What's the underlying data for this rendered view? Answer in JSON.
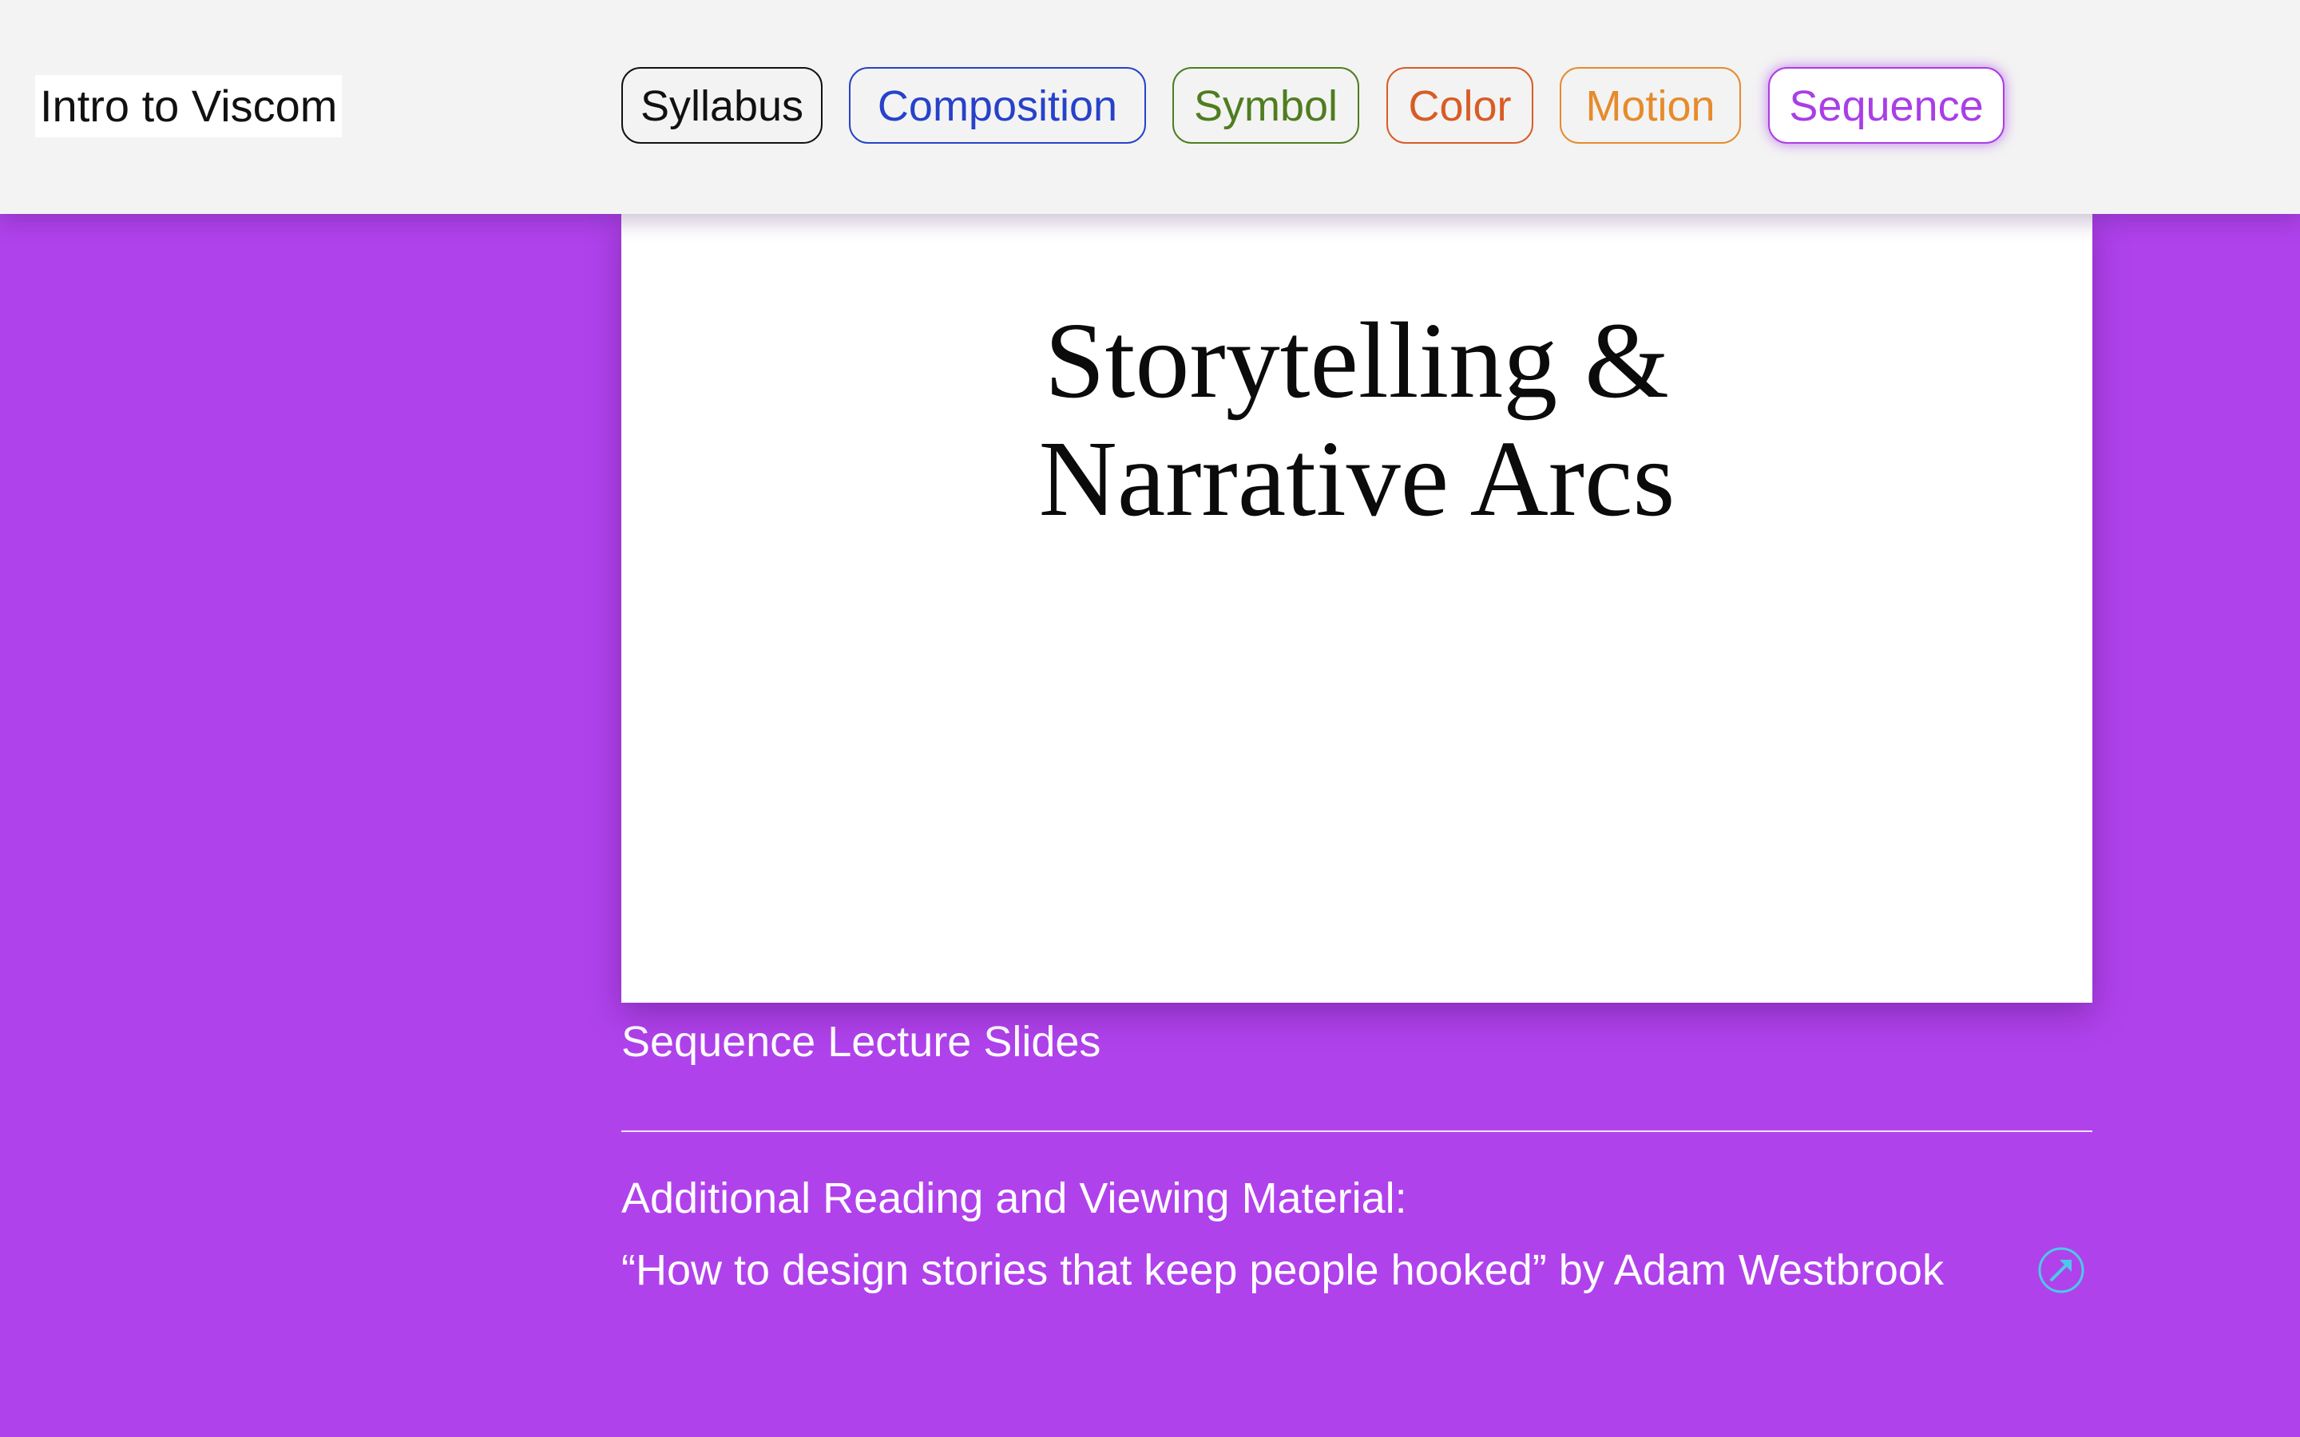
{
  "header": {
    "site_title": "Intro to Viscom",
    "nav": [
      {
        "label": "Syllabus",
        "color": "#111111",
        "active": false
      },
      {
        "label": "Composition",
        "color": "#2742c9",
        "active": false
      },
      {
        "label": "Symbol",
        "color": "#4f7d1f",
        "active": false
      },
      {
        "label": "Color",
        "color": "#d85c26",
        "active": false
      },
      {
        "label": "Motion",
        "color": "#e68b2c",
        "active": false
      },
      {
        "label": "Sequence",
        "color": "#a93ee6",
        "active": true
      }
    ]
  },
  "slide": {
    "title_line1": "Storytelling &",
    "title_line2": "Narrative Arcs"
  },
  "caption": "Sequence Lecture Slides",
  "reading": {
    "heading": "Additional Reading and Viewing Material:",
    "link_text": "“How to design stories that keep people hooked” by Adam Westbrook",
    "icon": "external-link-arrow-icon",
    "icon_color": "#4cc9e8"
  },
  "colors": {
    "page_background": "#b042ec",
    "header_background": "#f3f3f3"
  }
}
